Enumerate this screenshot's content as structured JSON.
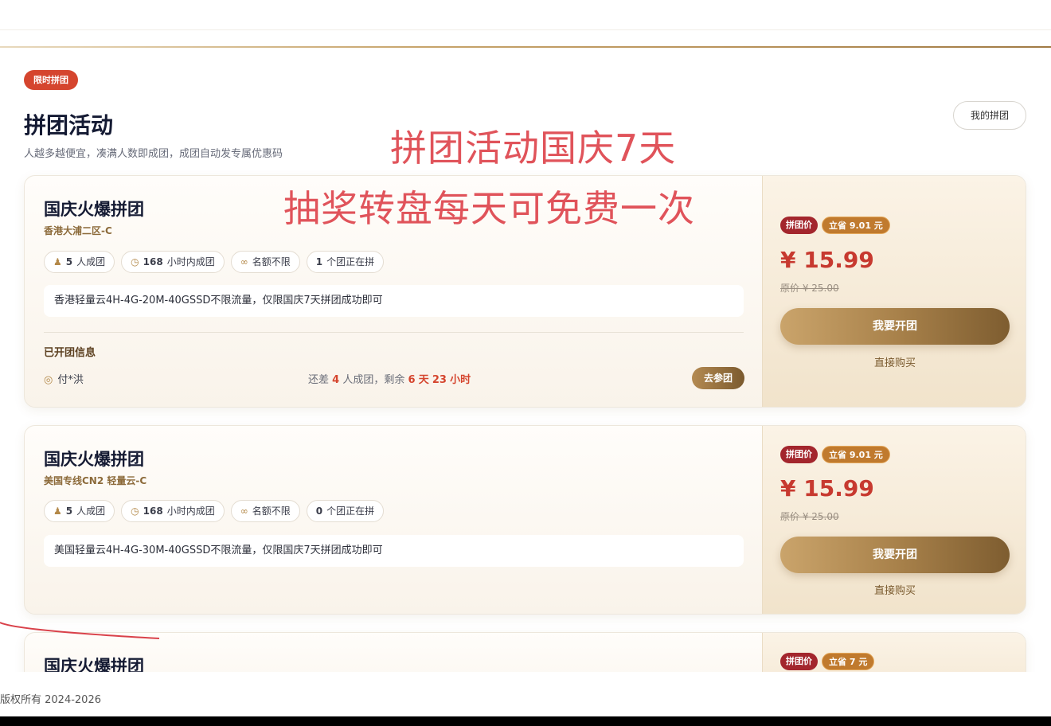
{
  "header": {
    "badge": "限时拼团",
    "title": "拼团活动",
    "subtitle": "人越多越便宜，凑满人数即成团，成团自动发专属优惠码",
    "my_group_button": "我的拼团"
  },
  "overlay_text": {
    "line1": "拼团活动国庆7天",
    "line2": "抽奖转盘每天可免费一次"
  },
  "cards": [
    {
      "title": "国庆火爆拼团",
      "region": "香港大浦二区-C",
      "chips": {
        "members": "5",
        "members_suffix": "人成团",
        "hours": "168",
        "hours_suffix": "小时内成团",
        "quota": "名额不限",
        "active": "1",
        "active_suffix": "个团正在拼"
      },
      "description": "香港轻量云4H-4G-20M-40GSSD不限流量，仅限国庆7天拼团成功即可",
      "opened": {
        "heading": "已开团信息",
        "member": "付*洪",
        "remain_prefix": "还差",
        "remain_people": "4",
        "remain_mid": "人成团，剩余",
        "remain_days": "6",
        "remain_day_unit": "天",
        "remain_hours": "23",
        "remain_hour_unit": "小时",
        "join_button": "去参团"
      },
      "tag_group": "拼团价",
      "tag_save": "立省 9.01 元",
      "price": "¥ 15.99",
      "original_price": "原价 ¥ 25.00",
      "open_button": "我要开团",
      "buy_link": "直接购买"
    },
    {
      "title": "国庆火爆拼团",
      "region": "美国专线CN2 轻量云-C",
      "chips": {
        "members": "5",
        "members_suffix": "人成团",
        "hours": "168",
        "hours_suffix": "小时内成团",
        "quota": "名额不限",
        "active": "0",
        "active_suffix": "个团正在拼"
      },
      "description": "美国轻量云4H-4G-30M-40GSSD不限流量，仅限国庆7天拼团成功即可",
      "tag_group": "拼团价",
      "tag_save": "立省 9.01 元",
      "price": "¥ 15.99",
      "original_price": "原价 ¥ 25.00",
      "open_button": "我要开团",
      "buy_link": "直接购买"
    },
    {
      "title": "国庆火爆拼团",
      "tag_group": "拼团价",
      "tag_save": "立省 7 元"
    }
  ],
  "footer": {
    "copyright": "版权所有 2024-2026"
  },
  "icons": {
    "members": "users-icon",
    "hours": "clock-icon",
    "quota": "infinity-icon",
    "member": "user-circle-icon"
  },
  "colors": {
    "accent_red": "#d5452e",
    "gold": "#a9824b",
    "price_red": "#c7392f",
    "overlay_red": "#e0535a"
  }
}
